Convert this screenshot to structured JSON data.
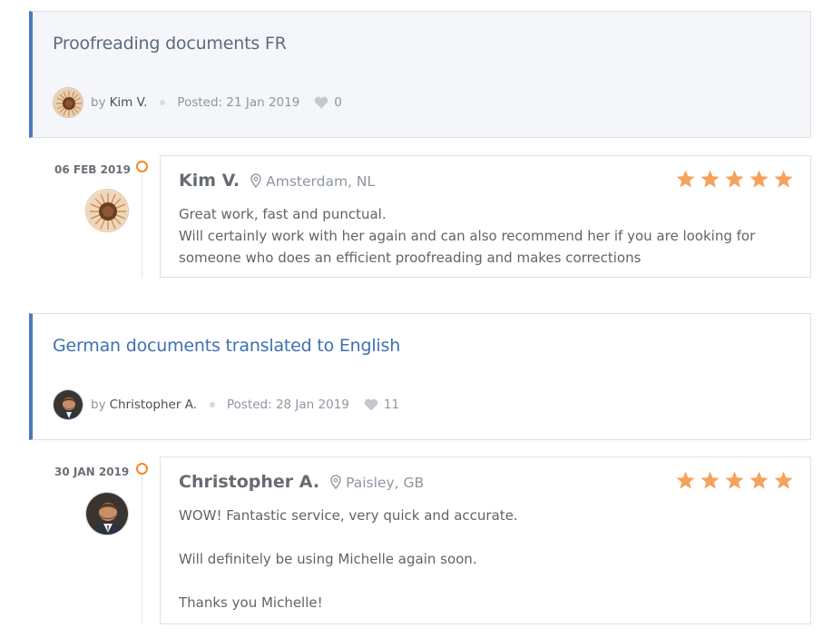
{
  "reviews": [
    {
      "job": {
        "title": "Proofreading documents FR",
        "by": "by",
        "author": "Kim V.",
        "posted": "Posted: 21 Jan 2019",
        "likes": "0"
      },
      "date": "06 FEB 2019",
      "reviewer": "Kim V.",
      "location": "Amsterdam, NL",
      "rating": 5,
      "lines": [
        "Great work, fast and punctual.",
        "Will certainly work with her again and can also recommend her if you are looking for",
        "someone who does an efficient proofreading and makes corrections"
      ]
    },
    {
      "job": {
        "title": "German documents translated to English",
        "by": "by",
        "author": "Christopher A.",
        "posted": "Posted: 28 Jan 2019",
        "likes": "11"
      },
      "date": "30 JAN 2019",
      "reviewer": "Christopher A.",
      "location": "Paisley, GB",
      "rating": 5,
      "lines": [
        "WOW! Fantastic service, very quick and accurate.",
        "Will definitely be using Michelle again soon.",
        "Thanks you Michelle!"
      ]
    }
  ],
  "colors": {
    "accent": "#4a79be",
    "star": "#f5a25d",
    "timeline": "#f08a24"
  }
}
